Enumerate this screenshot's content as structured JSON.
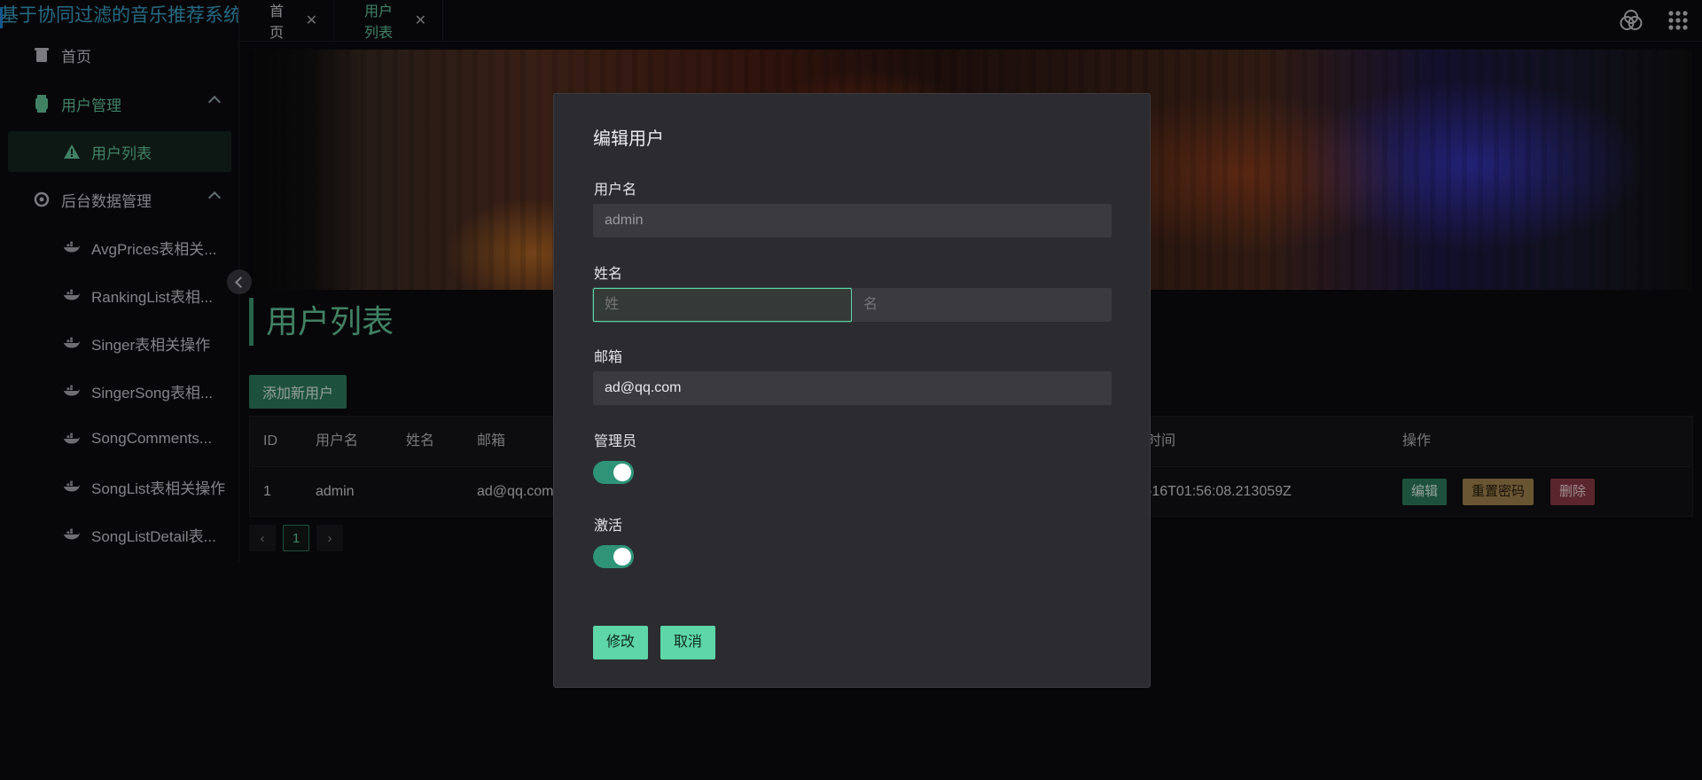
{
  "app": {
    "title": "基于协同过滤的音乐推荐系统"
  },
  "sidebar": {
    "home": "首页",
    "user_mgmt": "用户管理",
    "user_list": "用户列表",
    "backend_mgmt": "后台数据管理",
    "items": [
      "AvgPrices表相关...",
      "RankingList表相...",
      "Singer表相关操作",
      "SingerSong表相...",
      "SongComments...",
      "SongList表相关操作",
      "SongListDetail表..."
    ]
  },
  "tabs": [
    {
      "label": "首页"
    },
    {
      "label": "用户列表"
    }
  ],
  "page": {
    "title": "用户列表",
    "add_button": "添加新用户"
  },
  "table": {
    "headers": {
      "id": "ID",
      "username": "用户名",
      "name": "姓名",
      "email": "邮箱",
      "time": "时间",
      "ops": "操作"
    },
    "row": {
      "id": "1",
      "username": "admin",
      "name": "",
      "email": "ad@qq.com",
      "time": "-16T01:56:08.213059Z"
    },
    "ops": {
      "edit": "编辑",
      "reset": "重置密码",
      "delete": "删除"
    }
  },
  "pager": {
    "current": "1"
  },
  "modal": {
    "title": "编辑用户",
    "username_label": "用户名",
    "username_value": "admin",
    "name_label": "姓名",
    "surname_placeholder": "姓",
    "given_placeholder": "名",
    "email_label": "邮箱",
    "email_value": "ad@qq.com",
    "admin_label": "管理员",
    "admin_on": true,
    "active_label": "激活",
    "active_on": true,
    "submit": "修改",
    "cancel": "取消"
  },
  "colors": {
    "accent": "#63c79b",
    "primary_btn": "#5ed6a8",
    "toggle_on": "#2f9378"
  }
}
